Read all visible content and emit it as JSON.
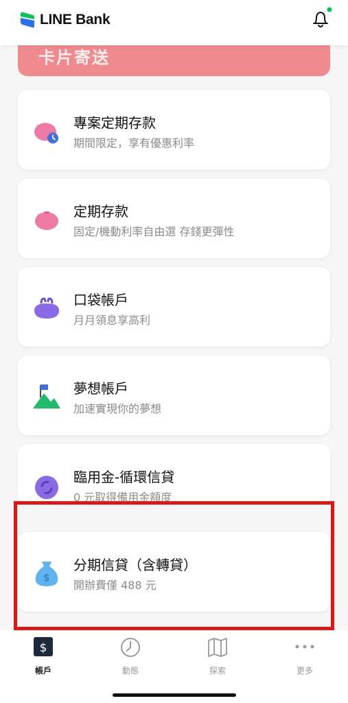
{
  "header": {
    "brand": "LINE Bank",
    "brand_color": "#06c755",
    "notification_dot_color": "#06c755"
  },
  "banner": {
    "text": "卡片寄送",
    "color": "#ef8a8e"
  },
  "products": [
    {
      "title": "專案定期存款",
      "subtitle": "期間限定，享有優惠利率",
      "icon": "piggy-bank-clock-icon"
    },
    {
      "title": "定期存款",
      "subtitle": "固定/機動利率自由選 存錢更彈性",
      "icon": "piggy-bank-icon"
    },
    {
      "title": "口袋帳戶",
      "subtitle": "月月領息享高利",
      "icon": "coin-purse-icon"
    },
    {
      "title": "夢想帳戶",
      "subtitle": "加速實現你的夢想",
      "icon": "mountain-flag-icon"
    },
    {
      "title": "臨用金-循環信貸",
      "subtitle": "0 元取得備用金額度",
      "icon": "revolving-credit-icon"
    },
    {
      "title": "分期信貸（含轉貸）",
      "subtitle": "開辦費僅 488 元",
      "icon": "money-bag-icon"
    }
  ],
  "highlight_color": "#e41414",
  "tabbar": {
    "tabs": [
      {
        "label": "帳戶",
        "icon": "dollar-account-icon",
        "active": true
      },
      {
        "label": "動態",
        "icon": "clock-icon",
        "active": false
      },
      {
        "label": "探索",
        "icon": "map-icon",
        "active": false
      },
      {
        "label": "更多",
        "icon": "more-dots-icon",
        "active": false
      }
    ]
  }
}
